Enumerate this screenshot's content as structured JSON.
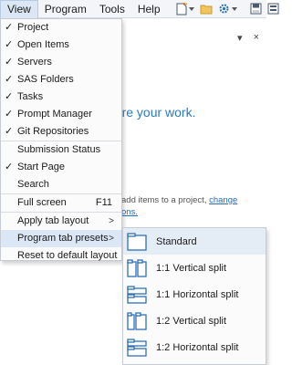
{
  "menubar": {
    "items": [
      "View",
      "Program",
      "Tools",
      "Help"
    ],
    "active": "View"
  },
  "toolbar": {
    "icons": [
      "new-icon",
      "open-folder-icon",
      "settings-gear-icon",
      "save-icon",
      "save-all-icon"
    ]
  },
  "background": {
    "panel_icons": [
      "▾",
      "×"
    ],
    "share_text": "hare your work.",
    "line1_prefix": "add items to a project,",
    "line1_link": "change",
    "line2": "ons."
  },
  "view_menu": {
    "items": [
      {
        "label": "Project",
        "checked": true
      },
      {
        "label": "Open Items",
        "checked": true
      },
      {
        "label": "Servers",
        "checked": true
      },
      {
        "label": "SAS Folders",
        "checked": true
      },
      {
        "label": "Tasks",
        "checked": true
      },
      {
        "label": "Prompt Manager",
        "checked": true
      },
      {
        "label": "Git Repositories",
        "checked": true
      },
      {
        "label": "Submission Status",
        "checked": false
      },
      {
        "label": "Start Page",
        "checked": true
      },
      {
        "label": "Search",
        "checked": false
      },
      {
        "label": "Full screen",
        "checked": false,
        "shortcut": "F11"
      },
      {
        "label": "Apply tab layout",
        "checked": false,
        "submenu": true
      },
      {
        "label": "Program tab presets",
        "checked": false,
        "submenu": true
      },
      {
        "label": "Reset to default layout",
        "checked": false
      }
    ]
  },
  "submenu": {
    "items": [
      {
        "label": "Standard",
        "icon": "standard-layout-icon"
      },
      {
        "label": "1:1 Vertical split",
        "icon": "vertical-split-1-1-icon"
      },
      {
        "label": "1:1 Horizontal split",
        "icon": "horizontal-split-1-1-icon"
      },
      {
        "label": "1:2 Vertical split",
        "icon": "vertical-split-1-2-icon"
      },
      {
        "label": "1:2 Horizontal split",
        "icon": "horizontal-split-1-2-icon"
      }
    ]
  },
  "colors": {
    "accent": "#2a7abf",
    "icon_blue": "#2f6fb5",
    "hover": "#dbe7f4"
  }
}
